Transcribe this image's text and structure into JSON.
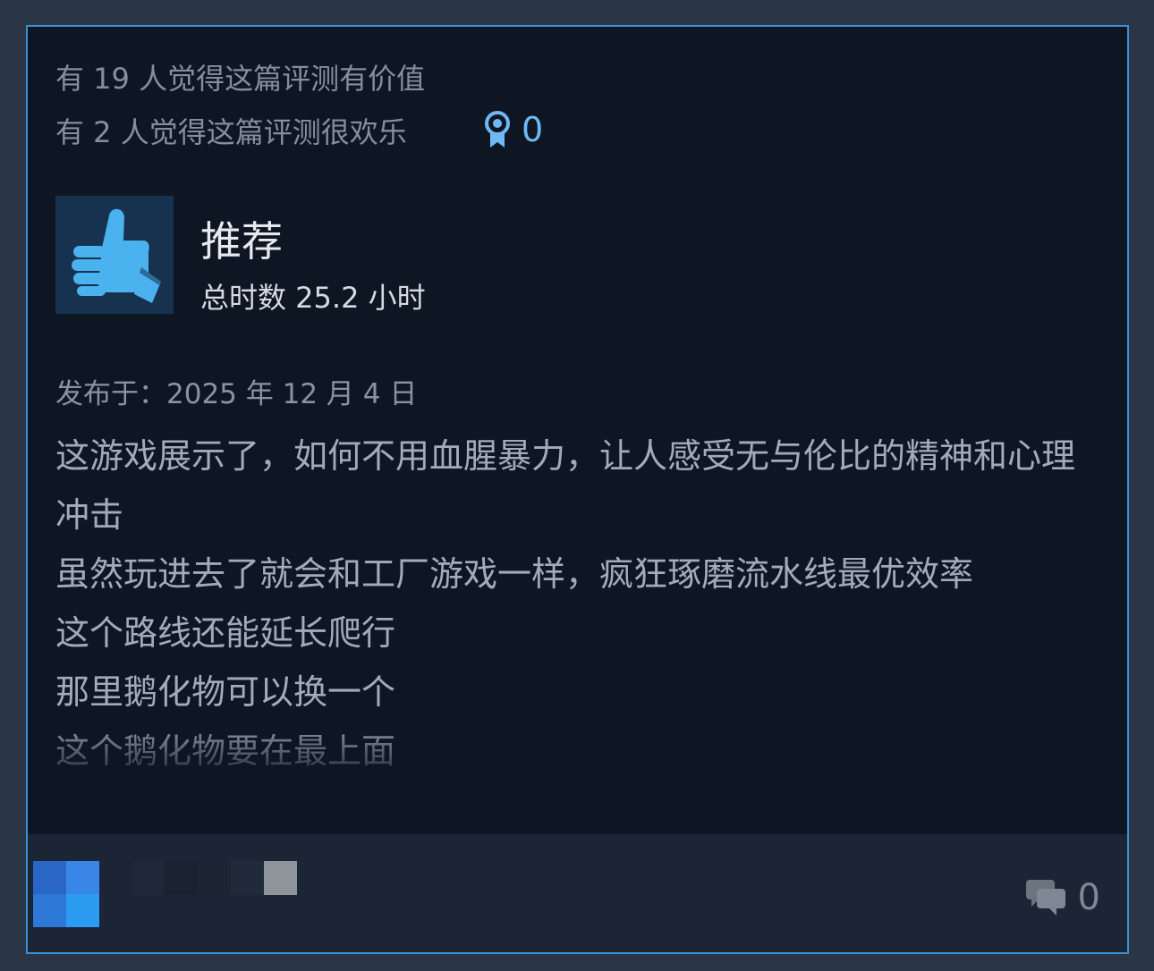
{
  "review": {
    "helpful_text": "有 19 人觉得这篇评测有价值",
    "funny_text": "有 2 人觉得这篇评测很欢乐",
    "award_count": "0",
    "verdict": "推荐",
    "playtime": "总时数 25.2 小时",
    "posted": "发布于：2025 年 12 月 4 日",
    "body_lines": [
      "这游戏展示了，如何不用血腥暴力，让人感受无与伦比的精神和心理冲击",
      "虽然玩进去了就会和工厂游戏一样，疯狂琢磨流水线最优效率",
      "这个路线还能延长爬行",
      "那里鹅化物可以换一个",
      "这个鹅化物要在最上面"
    ]
  },
  "footer": {
    "comment_count": "0"
  },
  "icons": {
    "award": "award-ribbon-icon",
    "thumb": "thumbs-up-icon",
    "comment": "comment-bubbles-icon"
  },
  "colors": {
    "card_border": "#3b8fd6",
    "card_bg": "#0e1623",
    "thumb_fill": "#4ab2ee",
    "award_accent": "#6fb8f4"
  }
}
